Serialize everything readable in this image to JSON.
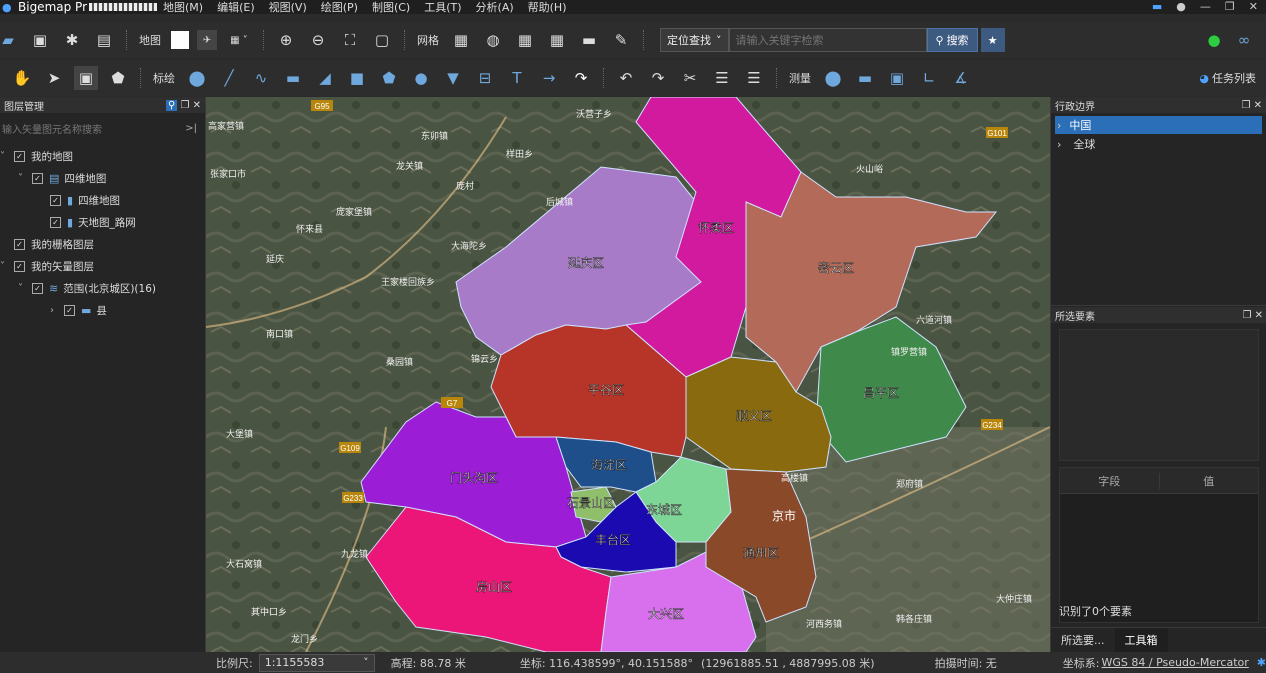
{
  "app": {
    "name": "Bigemap Pr"
  },
  "menu": [
    "地图(M)",
    "编辑(E)",
    "视图(V)",
    "绘图(P)",
    "制图(C)",
    "工具(T)",
    "分析(A)",
    "帮助(H)"
  ],
  "toolbar1": {
    "map_label": "地图",
    "grid_label": "网格",
    "locate_label": "定位查找",
    "search_placeholder": "请输入关键字检索",
    "search_button": "搜索"
  },
  "toolbar2": {
    "annotate_label": "标绘",
    "measure_label": "测量",
    "tasklist_label": "任务列表"
  },
  "layer_panel": {
    "title": "图层管理",
    "search_placeholder": "输入矢量图元名称搜索",
    "items": [
      {
        "label": "我的地图",
        "indent": 0,
        "icon": "none"
      },
      {
        "label": "四维地图",
        "indent": 1,
        "icon": "map"
      },
      {
        "label": "四维地图",
        "indent": 2,
        "icon": "book"
      },
      {
        "label": "天地图_路网",
        "indent": 2,
        "icon": "book"
      },
      {
        "label": "我的栅格图层",
        "indent": 0,
        "icon": "none"
      },
      {
        "label": "我的矢量图层",
        "indent": 0,
        "icon": "none"
      },
      {
        "label": "范围(北京城区)(16)",
        "indent": 1,
        "icon": "layers"
      },
      {
        "label": "县",
        "indent": 2,
        "icon": "folder"
      }
    ]
  },
  "districts": [
    "延庆区",
    "怀柔区",
    "密云区",
    "昌平区",
    "顺义区",
    "平谷区",
    "门头沟区",
    "海淀区",
    "石景山区",
    "东城区",
    "丰台区",
    "房山区",
    "大兴区",
    "通州区"
  ],
  "district_colors": {
    "延庆区": "#a87bc8",
    "怀柔区": "#d11a9e",
    "密云区": "#b46a58",
    "昌平区": "#b73428",
    "顺义区": "#8a6a0e",
    "平谷区": "#3f8a4a",
    "门头沟区": "#9b1ed6",
    "海淀区": "#1f4f8a",
    "石景山区": "#8fbf6a",
    "东城区": "#7ed696",
    "丰台区": "#1a0ab0",
    "房山区": "#ec1578",
    "大兴区": "#d870ee",
    "通州区": "#8a4a2a"
  },
  "map_places": [
    "高家营镇",
    "东卯镇",
    "样田乡",
    "沃营子乡",
    "庞村",
    "庞家堡镇",
    "龙关镇",
    "张家口市",
    "后城镇",
    "大海陀乡",
    "王家楼回族乡",
    "怀来县",
    "桑园镇",
    "延庆",
    "锦云乡",
    "大堡镇",
    "九龙镇",
    "火山峪",
    "南口镇",
    "六道河镇",
    "高楼镇",
    "郑府镇",
    "镇罗营镇",
    "大石窝镇",
    "其中口乡",
    "龙门乡",
    "河西务镇",
    "大仲庄镇",
    "韩各庄镇",
    "曹庄乡",
    "京市"
  ],
  "road_labels": [
    "G95",
    "G101",
    "G7",
    "G109",
    "G233",
    "G234",
    "G95"
  ],
  "right_panel": {
    "admin_title": "行政边界",
    "admin_items": [
      "中国",
      "全球"
    ],
    "selected_title": "所选要素",
    "col_field": "字段",
    "col_value": "值",
    "identified": "识别了0个要素",
    "tabs": [
      "所选要...",
      "工具箱"
    ]
  },
  "status": {
    "scale_label": "比例尺:",
    "scale_value": "1:1155583",
    "elevation": "高程: 88.78 米",
    "coord": "坐标: 116.438599°, 40.151588°",
    "projected": "(12961885.51 , 4887995.08 米)",
    "capture_time": "拍摄时间: 无",
    "crs_label": "坐标系:",
    "crs_value": "WGS 84 / Pseudo-Mercator"
  }
}
